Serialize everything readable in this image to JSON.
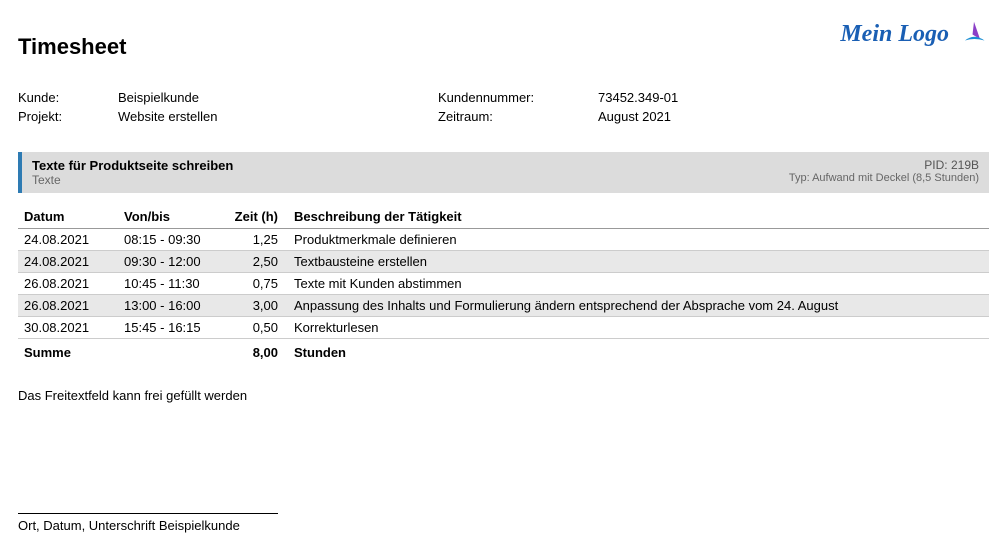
{
  "header": {
    "title": "Timesheet",
    "logo_text": "Mein Logo"
  },
  "meta": {
    "kunde_label": "Kunde:",
    "kunde_value": "Beispielkunde",
    "projekt_label": "Projekt:",
    "projekt_value": "Website erstellen",
    "kundennummer_label": "Kundennummer:",
    "kundennummer_value": "73452.349-01",
    "zeitraum_label": "Zeitraum:",
    "zeitraum_value": "August 2021"
  },
  "section": {
    "title": "Texte für Produktseite schreiben",
    "subtitle": "Texte",
    "pid": "PID: 219B",
    "typ": "Typ: Aufwand mit Deckel (8,5 Stunden)"
  },
  "table": {
    "headers": {
      "datum": "Datum",
      "vonbis": "Von/bis",
      "zeit": "Zeit (h)",
      "beschreibung": "Beschreibung der Tätigkeit"
    },
    "rows": [
      {
        "datum": "24.08.2021",
        "vonbis": "08:15 - 09:30",
        "zeit": "1,25",
        "descr": "Produktmerkmale definieren"
      },
      {
        "datum": "24.08.2021",
        "vonbis": "09:30 - 12:00",
        "zeit": "2,50",
        "descr": "Textbausteine erstellen"
      },
      {
        "datum": "26.08.2021",
        "vonbis": "10:45 - 11:30",
        "zeit": "0,75",
        "descr": "Texte mit Kunden abstimmen"
      },
      {
        "datum": "26.08.2021",
        "vonbis": "13:00 - 16:00",
        "zeit": "3,00",
        "descr": "Anpassung des Inhalts und Formulierung ändern entsprechend der Absprache vom 24. August"
      },
      {
        "datum": "30.08.2021",
        "vonbis": "15:45 - 16:15",
        "zeit": "0,50",
        "descr": "Korrekturlesen"
      }
    ],
    "summary": {
      "label": "Summe",
      "zeit": "8,00",
      "unit": "Stunden"
    }
  },
  "freetext": "Das Freitextfeld kann frei gefüllt werden",
  "signature": "Ort, Datum, Unterschrift Beispielkunde"
}
